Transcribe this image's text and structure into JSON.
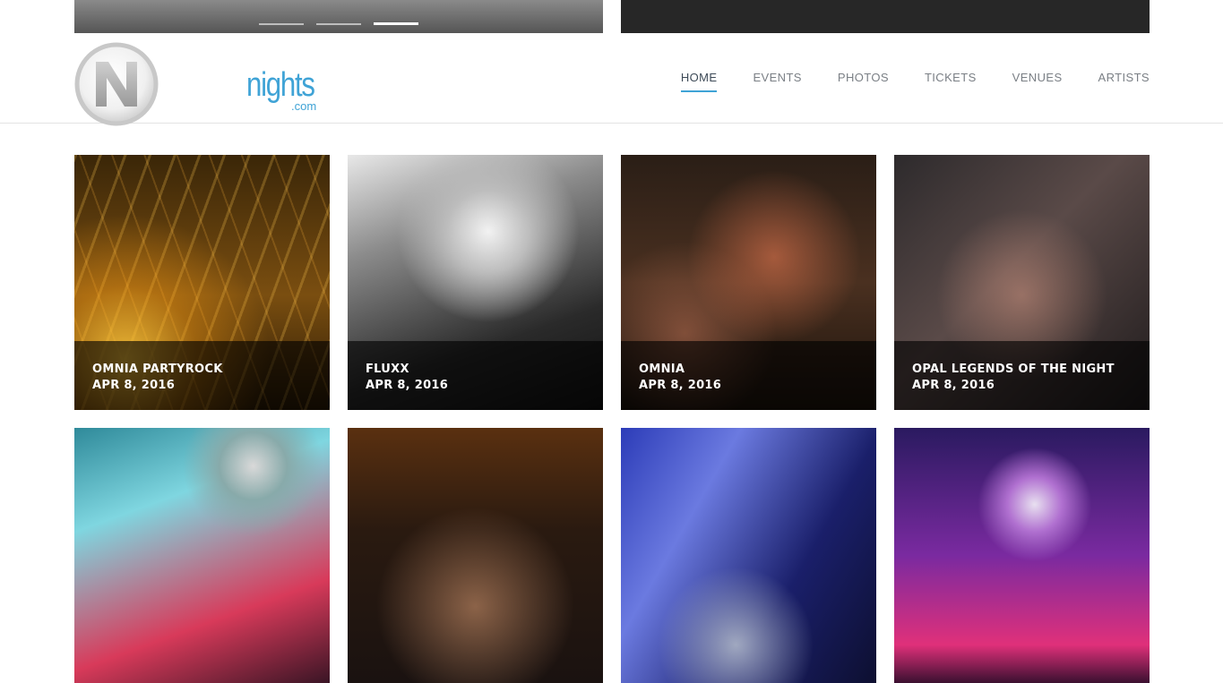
{
  "slider": {
    "dots": [
      {
        "active": false
      },
      {
        "active": false
      },
      {
        "active": true
      }
    ]
  },
  "brand": {
    "logo_letter": "N",
    "wordmark": "nights",
    "tld": ".com"
  },
  "nav": {
    "items": [
      {
        "label": "HOME",
        "active": true
      },
      {
        "label": "EVENTS",
        "active": false
      },
      {
        "label": "PHOTOS",
        "active": false
      },
      {
        "label": "TICKETS",
        "active": false
      },
      {
        "label": "VENUES",
        "active": false
      },
      {
        "label": "ARTISTS",
        "active": false
      }
    ]
  },
  "galleries": [
    {
      "title": "OMNIA PARTYROCK",
      "date": "APR 8, 2016"
    },
    {
      "title": "FLUXX",
      "date": "APR 8, 2016"
    },
    {
      "title": "OMNIA",
      "date": "APR 8, 2016"
    },
    {
      "title": "OPAL LEGENDS OF THE NIGHT",
      "date": "APR 8, 2016"
    },
    {
      "title": "",
      "date": ""
    },
    {
      "title": "",
      "date": ""
    },
    {
      "title": "",
      "date": ""
    },
    {
      "title": "",
      "date": ""
    }
  ],
  "colors": {
    "accent": "#3fa3d6",
    "nav_text": "#7a7f85",
    "nav_active": "#3d4a57",
    "overlay": "rgba(0,0,0,0.62)"
  }
}
